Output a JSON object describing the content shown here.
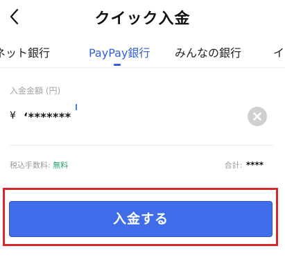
{
  "header": {
    "title": "クイック入金"
  },
  "tabs": [
    {
      "label": "ネット銀行",
      "active": false
    },
    {
      "label": "PayPay銀行",
      "active": true
    },
    {
      "label": "みんなの銀行",
      "active": false
    },
    {
      "label": "イ",
      "active": false
    }
  ],
  "amount": {
    "label": "入金金額 (円)",
    "currency": "¥",
    "value": "‘*******"
  },
  "fee": {
    "label": "税込手数料:",
    "value": "無料"
  },
  "total": {
    "label": "合計:",
    "value": "****"
  },
  "submit": {
    "label": "入金する"
  },
  "colors": {
    "accent": "#2f5fdf",
    "button": "#3f6ce8",
    "fee": "#29a36b",
    "highlight": "#d8262b"
  },
  "icons": {
    "back": "back-arrow-icon",
    "clear": "clear-icon"
  }
}
